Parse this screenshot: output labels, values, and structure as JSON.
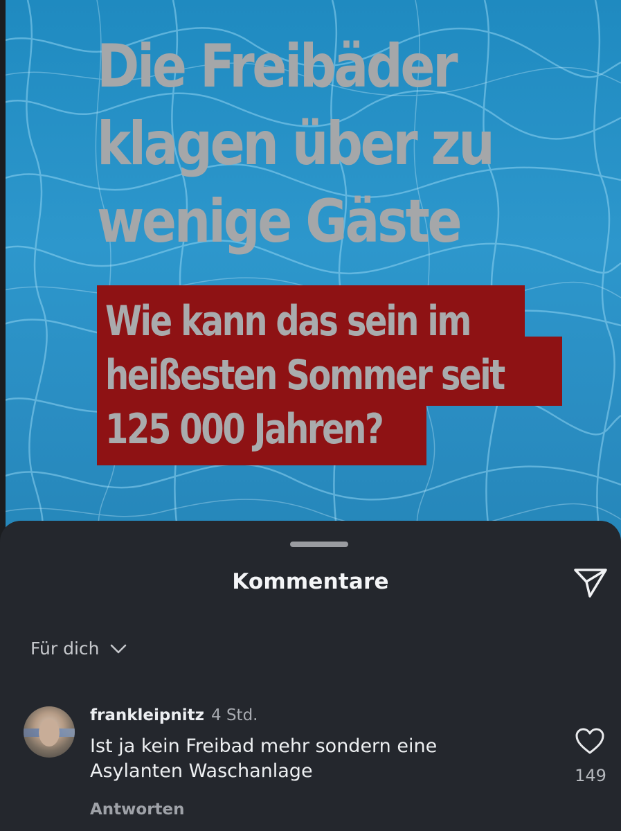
{
  "post": {
    "headline": "Die Freibäder\nklagen über zu\nwenige Gäste",
    "subheadline": "Wie kann das sein im\nheißesten Sommer seit\n125 000 Jahren?",
    "colors": {
      "water": "#2a92c6",
      "headline_text": "#a5a7a9",
      "subheadline_bg": "#8e1214"
    }
  },
  "comments_sheet": {
    "title": "Kommentare",
    "share_icon": "paper-plane-icon",
    "filter_label": "Für dich",
    "filter_icon": "chevron-down-icon",
    "comments": [
      {
        "username": "frankleipnitz",
        "timestamp": "4 Std.",
        "text": "Ist ja kein Freibad mehr sondern eine\nAsylanten Waschanlage",
        "reply_label": "Antworten",
        "like_icon": "heart-icon",
        "likes": "149"
      }
    ]
  }
}
